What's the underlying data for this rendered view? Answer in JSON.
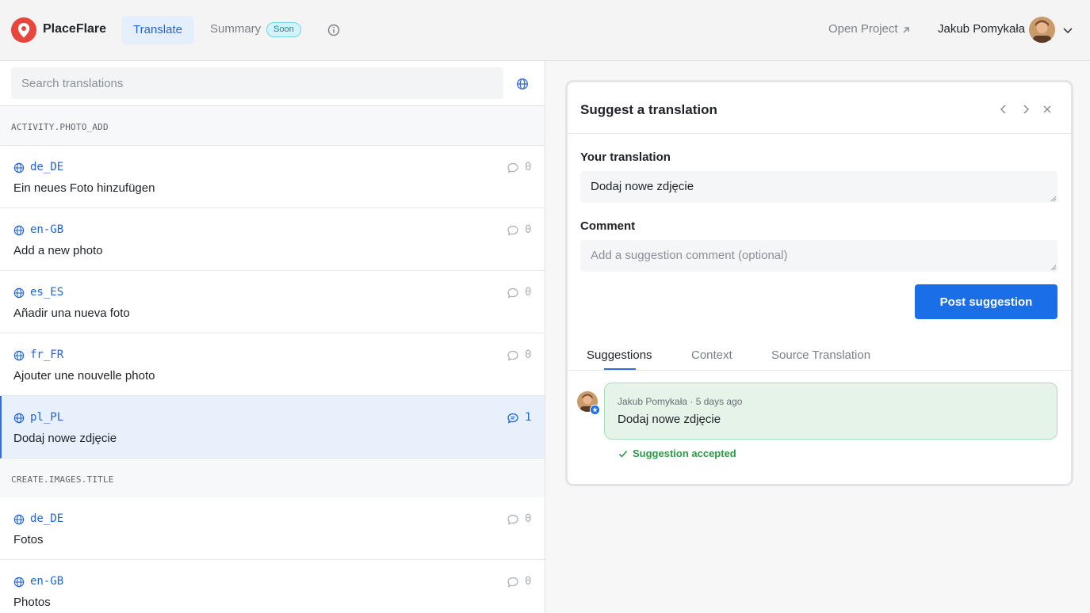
{
  "header": {
    "brand": "PlaceFlare",
    "tabs": {
      "translate": "Translate",
      "summary": "Summary"
    },
    "soon_badge": "Soon",
    "open_project": "Open Project",
    "user_name": "Jakub Pomykała"
  },
  "search": {
    "placeholder": "Search translations"
  },
  "groups": [
    {
      "key": "ACTIVITY.PHOTO_ADD",
      "rows": [
        {
          "locale": "de_DE",
          "text": "Ein neues Foto hinzufügen",
          "count": "0"
        },
        {
          "locale": "en-GB",
          "text": "Add a new photo",
          "count": "0"
        },
        {
          "locale": "es_ES",
          "text": "Añadir una nueva foto",
          "count": "0"
        },
        {
          "locale": "fr_FR",
          "text": "Ajouter une nouvelle photo",
          "count": "0"
        },
        {
          "locale": "pl_PL",
          "text": "Dodaj nowe zdjęcie",
          "count": "1"
        }
      ]
    },
    {
      "key": "CREATE.IMAGES.TITLE",
      "rows": [
        {
          "locale": "de_DE",
          "text": "Fotos",
          "count": "0"
        },
        {
          "locale": "en-GB",
          "text": "Photos",
          "count": "0"
        }
      ]
    }
  ],
  "panel": {
    "title": "Suggest a translation",
    "your_translation_label": "Your translation",
    "your_translation_value": "Dodaj nowe zdjęcie",
    "comment_label": "Comment",
    "comment_placeholder": "Add a suggestion comment (optional)",
    "post_button": "Post suggestion",
    "tabs": [
      "Suggestions",
      "Context",
      "Source Translation"
    ],
    "suggestion": {
      "author": "Jakub Pomykała",
      "age": "5 days ago",
      "text": "Dodaj nowe zdjęcie",
      "status": "Suggestion accepted"
    }
  },
  "colors": {
    "accent": "#1a6fe8",
    "success": "#2a9a45",
    "brand": "#e8453c"
  }
}
